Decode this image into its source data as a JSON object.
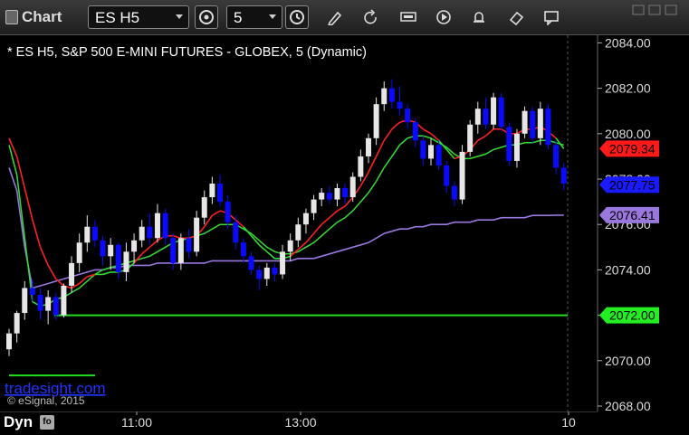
{
  "app": {
    "title": "Chart"
  },
  "toolbar": {
    "symbol": "ES H5",
    "interval": "5",
    "icons": [
      "chart-settings-icon",
      "clock-icon",
      "pencil-icon",
      "refresh-icon",
      "quote-icon",
      "play-icon",
      "eraser-icon",
      "chat-icon"
    ]
  },
  "chart": {
    "header": "* ES H5, S&P 500 E-MINI FUTURES - GLOBEX, 5 (Dynamic)",
    "watermark": "tradesight.com",
    "copyright": "© eSignal, 2015",
    "colors": {
      "background": "#000000",
      "up_candle": "#e6e6e6",
      "down_candle": "#0a0aff",
      "ma_green": "#33dd33",
      "ma_red": "#ff2020",
      "vwap": "#9977dd",
      "level": "#22dd22"
    }
  },
  "chart_data": {
    "type": "candlestick",
    "y_range": [
      2068,
      2085
    ],
    "y_ticks": [
      "2084.00",
      "2082.00",
      "2080.00",
      "2078.00",
      "2076.00",
      "2074.00",
      "2072.00",
      "2070.00",
      "2068.00"
    ],
    "x_ticks": [
      "11:00",
      "13:00",
      "10"
    ],
    "price_tags": [
      {
        "label": "2079.34",
        "value": 2079.34,
        "color": "#ff1a1a"
      },
      {
        "label": "2077.75",
        "value": 2077.75,
        "color": "#1a1aff"
      },
      {
        "label": "2076.41",
        "value": 2076.41,
        "color": "#9977dd"
      },
      {
        "label": "2072.00",
        "value": 2072.0,
        "color": "#22ee22"
      }
    ],
    "candles": [
      [
        2070.5,
        2071.4,
        2070.2,
        2071.2
      ],
      [
        2071.2,
        2072.2,
        2070.8,
        2072.1
      ],
      [
        2072.1,
        2073.5,
        2071.8,
        2073.2
      ],
      [
        2073.2,
        2073.6,
        2072.6,
        2072.9
      ],
      [
        2072.9,
        2073.2,
        2071.8,
        2072.2
      ],
      [
        2072.2,
        2073.1,
        2071.6,
        2072.8
      ],
      [
        2072.8,
        2073.0,
        2071.8,
        2072.0
      ],
      [
        2072.0,
        2073.4,
        2071.9,
        2073.3
      ],
      [
        2073.3,
        2074.6,
        2073.0,
        2074.3
      ],
      [
        2074.3,
        2075.6,
        2073.9,
        2075.2
      ],
      [
        2075.2,
        2076.4,
        2074.8,
        2075.9
      ],
      [
        2075.9,
        2076.2,
        2075.0,
        2075.3
      ],
      [
        2075.3,
        2075.5,
        2074.2,
        2074.6
      ],
      [
        2074.6,
        2075.4,
        2074.0,
        2075.1
      ],
      [
        2075.1,
        2075.2,
        2073.6,
        2073.9
      ],
      [
        2073.9,
        2075.2,
        2073.5,
        2074.8
      ],
      [
        2074.8,
        2075.6,
        2074.3,
        2075.3
      ],
      [
        2075.3,
        2076.2,
        2075.0,
        2075.9
      ],
      [
        2075.9,
        2076.5,
        2075.1,
        2075.4
      ],
      [
        2075.4,
        2076.9,
        2075.2,
        2076.5
      ],
      [
        2076.5,
        2076.7,
        2075.1,
        2075.4
      ],
      [
        2075.4,
        2075.6,
        2074.0,
        2074.3
      ],
      [
        2074.3,
        2075.6,
        2074.0,
        2075.4
      ],
      [
        2075.4,
        2075.8,
        2074.5,
        2074.8
      ],
      [
        2074.8,
        2076.6,
        2074.6,
        2076.3
      ],
      [
        2076.3,
        2077.5,
        2076.0,
        2077.2
      ],
      [
        2077.2,
        2078.1,
        2076.9,
        2077.8
      ],
      [
        2077.8,
        2078.2,
        2076.8,
        2077.0
      ],
      [
        2077.0,
        2077.3,
        2075.8,
        2076.1
      ],
      [
        2076.1,
        2076.4,
        2074.9,
        2075.2
      ],
      [
        2075.2,
        2075.4,
        2074.3,
        2074.6
      ],
      [
        2074.6,
        2074.8,
        2073.8,
        2074.0
      ],
      [
        2074.0,
        2074.2,
        2073.1,
        2073.6
      ],
      [
        2073.6,
        2074.3,
        2073.3,
        2074.1
      ],
      [
        2074.1,
        2074.3,
        2073.5,
        2073.8
      ],
      [
        2073.8,
        2075.1,
        2073.6,
        2074.8
      ],
      [
        2074.8,
        2075.6,
        2074.4,
        2075.3
      ],
      [
        2075.3,
        2076.3,
        2075.0,
        2076.0
      ],
      [
        2076.0,
        2076.7,
        2075.6,
        2076.5
      ],
      [
        2076.5,
        2077.3,
        2076.2,
        2077.1
      ],
      [
        2077.1,
        2077.6,
        2076.8,
        2077.4
      ],
      [
        2077.4,
        2077.7,
        2076.9,
        2077.1
      ],
      [
        2077.1,
        2077.8,
        2076.8,
        2077.6
      ],
      [
        2077.6,
        2077.8,
        2076.9,
        2077.2
      ],
      [
        2077.2,
        2078.3,
        2077.0,
        2078.1
      ],
      [
        2078.1,
        2079.3,
        2077.9,
        2079.0
      ],
      [
        2079.0,
        2080.0,
        2078.7,
        2079.8
      ],
      [
        2079.8,
        2081.6,
        2079.5,
        2081.3
      ],
      [
        2081.3,
        2082.3,
        2081.0,
        2082.0
      ],
      [
        2082.0,
        2082.4,
        2081.1,
        2081.4
      ],
      [
        2081.4,
        2082.1,
        2080.8,
        2081.1
      ],
      [
        2081.1,
        2081.3,
        2080.2,
        2080.5
      ],
      [
        2080.5,
        2080.7,
        2079.4,
        2079.7
      ],
      [
        2079.7,
        2079.9,
        2078.6,
        2078.9
      ],
      [
        2078.9,
        2079.8,
        2078.6,
        2079.5
      ],
      [
        2079.5,
        2079.7,
        2078.4,
        2078.6
      ],
      [
        2078.6,
        2078.8,
        2077.4,
        2077.7
      ],
      [
        2077.7,
        2077.9,
        2076.8,
        2077.1
      ],
      [
        2077.1,
        2079.5,
        2076.9,
        2079.2
      ],
      [
        2079.2,
        2080.6,
        2079.0,
        2080.4
      ],
      [
        2080.4,
        2081.4,
        2080.0,
        2081.1
      ],
      [
        2081.1,
        2081.6,
        2080.2,
        2080.4
      ],
      [
        2080.4,
        2081.8,
        2080.2,
        2081.6
      ],
      [
        2081.6,
        2081.8,
        2080.1,
        2080.3
      ],
      [
        2080.3,
        2080.5,
        2078.6,
        2078.8
      ],
      [
        2078.8,
        2080.2,
        2078.5,
        2080.0
      ],
      [
        2080.0,
        2081.2,
        2079.8,
        2081.0
      ],
      [
        2081.0,
        2081.2,
        2079.6,
        2079.8
      ],
      [
        2079.8,
        2081.4,
        2079.5,
        2081.1
      ],
      [
        2081.1,
        2081.3,
        2079.3,
        2079.5
      ],
      [
        2079.5,
        2079.7,
        2078.2,
        2078.5
      ],
      [
        2078.5,
        2078.7,
        2077.5,
        2077.8
      ]
    ],
    "ma_fast": [
      2079.8,
      2079.0,
      2077.6,
      2076.2,
      2075.0,
      2074.2,
      2073.6,
      2073.3,
      2073.2,
      2073.4,
      2073.7,
      2073.8,
      2073.8,
      2073.9,
      2073.9,
      2074.0,
      2074.3,
      2074.7,
      2075.0,
      2075.3,
      2075.5,
      2075.5,
      2075.4,
      2075.4,
      2075.5,
      2075.9,
      2076.4,
      2076.6,
      2076.5,
      2076.2,
      2075.9,
      2075.5,
      2075.1,
      2074.8,
      2074.5,
      2074.5,
      2074.6,
      2074.9,
      2075.2,
      2075.6,
      2076.0,
      2076.3,
      2076.6,
      2076.8,
      2077.2,
      2077.7,
      2078.3,
      2079.0,
      2079.7,
      2080.2,
      2080.5,
      2080.6,
      2080.5,
      2080.2,
      2080.0,
      2079.7,
      2079.3,
      2078.9,
      2079.0,
      2079.3,
      2079.7,
      2079.9,
      2080.2,
      2080.2,
      2080.0,
      2080.0,
      2080.2,
      2080.2,
      2080.3,
      2080.1,
      2079.8,
      2079.34
    ],
    "ma_slow": [
      2079.5,
      2078.2,
      2075.4,
      2072.6,
      2072.4,
      2072.5,
      2072.7,
      2072.8,
      2073.0,
      2073.2,
      2073.5,
      2073.8,
      2074.0,
      2074.1,
      2074.2,
      2074.3,
      2074.4,
      2074.5,
      2074.6,
      2074.8,
      2075.0,
      2075.2,
      2075.3,
      2075.4,
      2075.5,
      2075.6,
      2075.8,
      2076.0,
      2076.0,
      2076.0,
      2075.8,
      2075.6,
      2075.3,
      2075.0,
      2074.8,
      2074.7,
      2074.7,
      2074.8,
      2075.0,
      2075.2,
      2075.5,
      2075.8,
      2076.1,
      2076.3,
      2076.6,
      2077.0,
      2077.4,
      2077.9,
      2078.5,
      2079.0,
      2079.5,
      2079.8,
      2079.9,
      2079.9,
      2079.8,
      2079.6,
      2079.4,
      2079.1,
      2078.9,
      2078.9,
      2079.0,
      2079.1,
      2079.3,
      2079.4,
      2079.5,
      2079.5,
      2079.6,
      2079.6,
      2079.7,
      2079.7,
      2079.6,
      2079.5
    ],
    "vwap": [
      2078.5,
      2077.5,
      2075.0,
      2073.2,
      2073.3,
      2073.4,
      2073.5,
      2073.6,
      2073.7,
      2073.8,
      2073.9,
      2074.0,
      2074.0,
      2074.1,
      2074.1,
      2074.2,
      2074.2,
      2074.2,
      2074.2,
      2074.3,
      2074.3,
      2074.3,
      2074.3,
      2074.3,
      2074.3,
      2074.3,
      2074.4,
      2074.4,
      2074.4,
      2074.4,
      2074.4,
      2074.4,
      2074.4,
      2074.4,
      2074.4,
      2074.4,
      2074.4,
      2074.5,
      2074.5,
      2074.5,
      2074.6,
      2074.7,
      2074.8,
      2074.9,
      2075.0,
      2075.1,
      2075.2,
      2075.4,
      2075.6,
      2075.7,
      2075.8,
      2075.8,
      2075.9,
      2075.9,
      2076.0,
      2076.0,
      2076.0,
      2076.1,
      2076.1,
      2076.1,
      2076.2,
      2076.2,
      2076.2,
      2076.3,
      2076.3,
      2076.3,
      2076.3,
      2076.4,
      2076.4,
      2076.4,
      2076.41,
      2076.41
    ],
    "levels": [
      {
        "label": "2072.00",
        "value": 2072.0
      },
      {
        "label": "2069.50",
        "value": 2069.35
      }
    ]
  }
}
